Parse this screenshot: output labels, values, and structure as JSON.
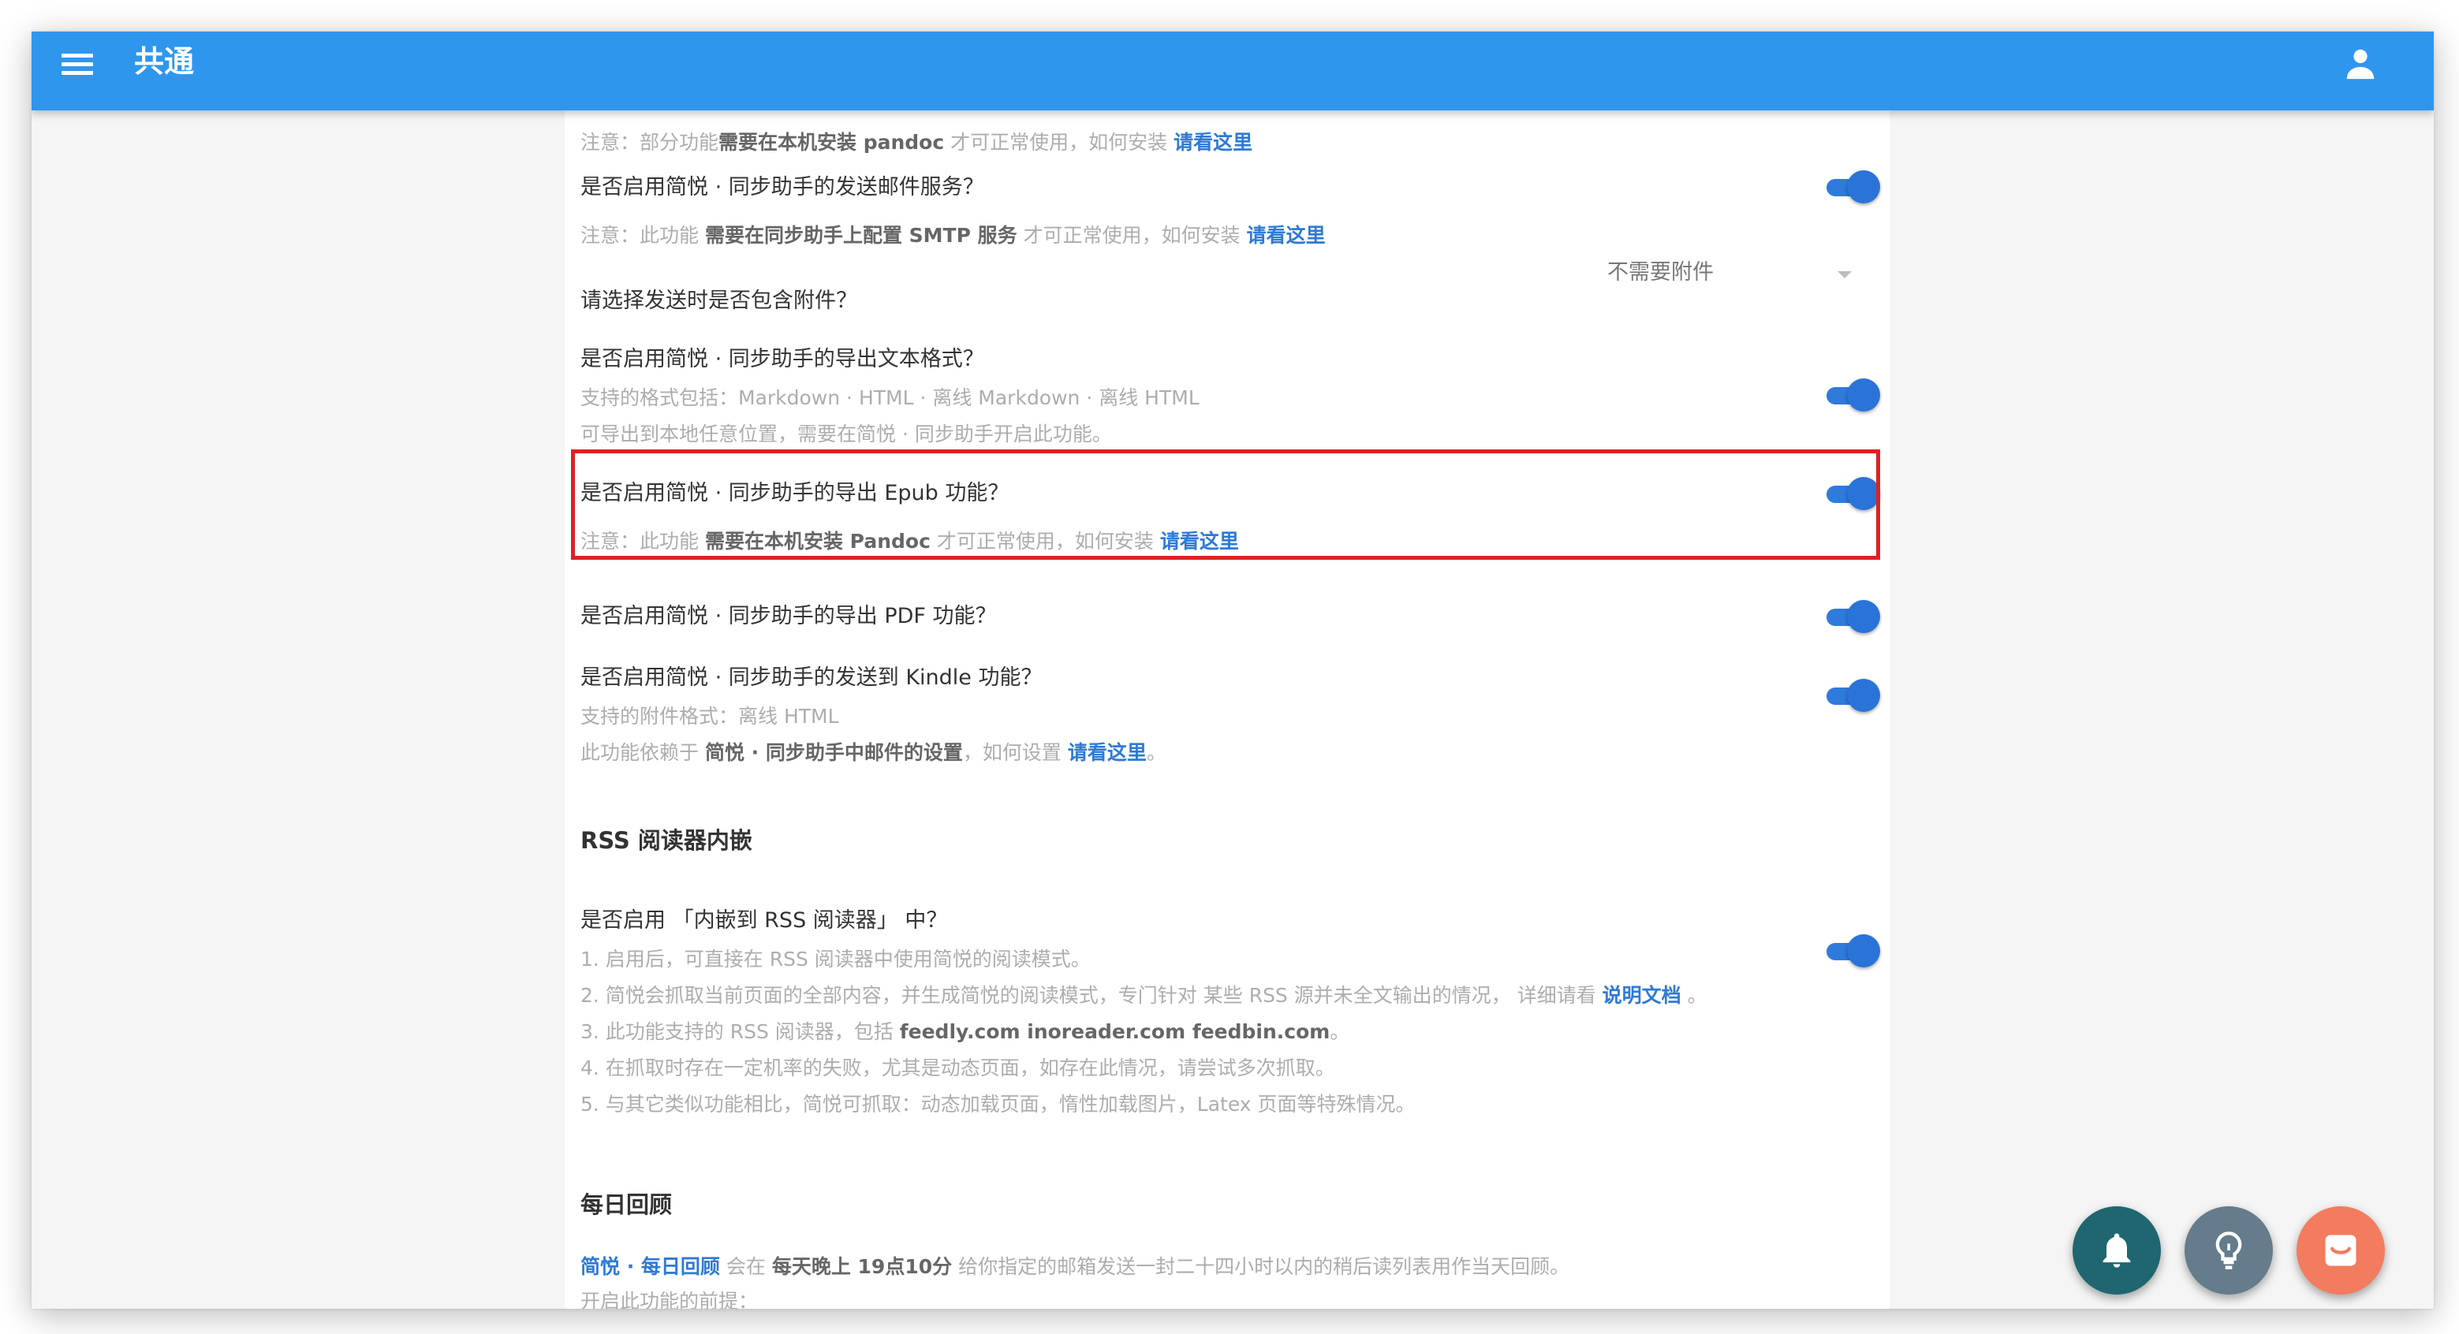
{
  "app_title": "共通",
  "sections": {
    "partial_note": {
      "prefix": "注意：部分功能",
      "strong": "需要在本机安装 pandoc",
      "middle": "才可正常使用，如何安装",
      "link": "请看这里"
    },
    "email_service": {
      "question": "是否启用简悦 · 同步助手的发送邮件服务？",
      "enabled": true,
      "note_prefix": "注意：此功能",
      "note_strong": "需要在同步助手上配置 SMTP 服务",
      "note_middle": "才可正常使用，如何安装",
      "note_link": "请看这里"
    },
    "attachment": {
      "question": "请选择发送时是否包含附件？",
      "selected": "不需要附件"
    },
    "text_export": {
      "question": "是否启用简悦 · 同步助手的导出文本格式？",
      "enabled": true,
      "line1": "支持的格式包括：Markdown · HTML · 离线 Markdown · 离线 HTML",
      "line2": "可导出到本地任意位置，需要在简悦 · 同步助手开启此功能。"
    },
    "epub": {
      "question": "是否启用简悦 · 同步助手的导出 Epub 功能？",
      "enabled": true,
      "note_prefix": "注意：此功能",
      "note_strong": "需要在本机安装 Pandoc",
      "note_middle": "才可正常使用，如何安装",
      "note_link": "请看这里"
    },
    "pdf": {
      "question": "是否启用简悦 · 同步助手的导出 PDF 功能？",
      "enabled": true
    },
    "kindle": {
      "question": "是否启用简悦 · 同步助手的发送到 Kindle 功能？",
      "enabled": true,
      "line1": "支持的附件格式：离线 HTML",
      "line2_prefix": "此功能依赖于",
      "line2_strong": "简悦 · 同步助手中邮件的设置",
      "line2_middle": "，如何设置",
      "line2_link": "请看这里",
      "line2_suffix": "。"
    },
    "rss": {
      "heading": "RSS 阅读器内嵌",
      "question": "是否启用 「内嵌到 RSS 阅读器」 中？",
      "enabled": true,
      "item1": "1. 启用后，可直接在 RSS 阅读器中使用简悦的阅读模式。",
      "item2_prefix": "2. 简悦会抓取当前页面的全部内容，并生成简悦的阅读模式，专门针对 某些 RSS 源并未全文输出的情况，  详细请看",
      "item2_link": "说明文档",
      "item2_suffix": "。",
      "item3_prefix": "3. 此功能支持的 RSS 阅读器，包括",
      "item3_strong": "feedly.com inoreader.com feedbin.com",
      "item3_suffix": "。",
      "item4": "4. 在抓取时存在一定机率的失败，尤其是动态页面，如存在此情况，请尝试多次抓取。",
      "item5": "5. 与其它类似功能相比，简悦可抓取：动态加载页面，惰性加载图片，Latex 页面等特殊情况。"
    },
    "daily": {
      "heading": "每日回顾",
      "line1_link": "简悦 · 每日回顾",
      "line1_middle": "会在",
      "line1_strong": "每天晚上 19点10分",
      "line1_suffix": "给你指定的邮箱发送一封二十四小时以内的稍后读列表用作当天回顾。",
      "line2": "开启此功能的前提："
    }
  },
  "icons": {
    "menu": "menu-icon",
    "account": "account-icon",
    "fab_bell": "bell-icon",
    "fab_bulb": "lightbulb-icon",
    "fab_message": "message-icon"
  },
  "colors": {
    "appbar": "#2f96ee",
    "toggle_on": "#2a73d9",
    "link": "#2e7ad6",
    "highlight": "#e02121",
    "fab_bell": "#1f6670",
    "fab_bulb": "#647c8b",
    "fab_message": "#f37b5e"
  }
}
